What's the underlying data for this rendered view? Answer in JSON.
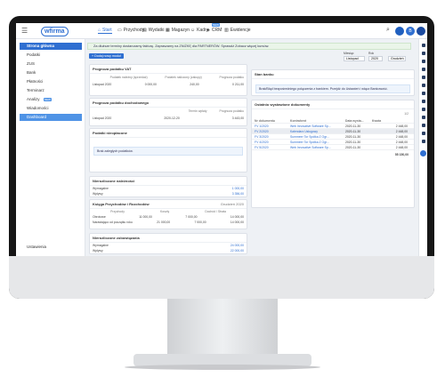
{
  "app": {
    "logo": "wfirma",
    "nav_tabs": [
      {
        "label": "Start",
        "icon": "home-icon"
      },
      {
        "label": "Przychody",
        "icon": "cart-icon"
      },
      {
        "label": "Wydatki",
        "icon": "receipt-icon"
      },
      {
        "label": "Magazyn",
        "icon": "box-icon"
      },
      {
        "label": "Kadry",
        "icon": "people-icon"
      },
      {
        "label": "CRM",
        "icon": "crm-icon",
        "badge": "NEW"
      },
      {
        "label": "Ewidencje",
        "icon": "book-icon"
      }
    ],
    "user_initial": "B"
  },
  "sidebar": {
    "header": "Strona główna",
    "items": [
      {
        "label": "Podatki",
        "icon": "percent-icon"
      },
      {
        "label": "ZUS",
        "icon": "zus-icon"
      },
      {
        "label": "Bank",
        "icon": "bank-icon"
      },
      {
        "label": "Płatności",
        "icon": "wallet-icon"
      },
      {
        "label": "Terminarz",
        "icon": "calendar-icon"
      },
      {
        "label": "Analizy",
        "icon": "chart-icon",
        "badge": "NEW"
      },
      {
        "label": "Wiadomości",
        "icon": "mail-icon"
      },
      {
        "label": "Dashboard",
        "icon": "dashboard-icon"
      }
    ],
    "footer": "Ustawienia"
  },
  "main": {
    "alert": "Za dłuższe terminy dostarczamy fakturę. Zapraszamy na ZNIŻKĘ dla PARTNERÓW. Sprawdź Zobacz więcej kursów.",
    "add_button": "+ Dodaj nowy moduł",
    "year_filter": {
      "label": "Rok",
      "value": "2020"
    },
    "month_filter": {
      "label": "Miesiąc",
      "value": "Listopad"
    },
    "month_select": "Grudzień",
    "cards": {
      "income_forecast": {
        "title": "Prognoza podatku VAT",
        "cols": [
          "Podatek należny (sprzedaż)",
          "Podatek naliczony (zakupy)",
          "Prognoza podatku"
        ],
        "row": {
          "period": "Listopad 2020",
          "a": "0 000,00",
          "b": "240,00",
          "c": "0 211,00"
        }
      },
      "income_tax": {
        "title": "Prognoza podatku dochodowego",
        "cols": [
          "Termin wpłaty",
          "Prognoza podatku"
        ],
        "row": {
          "period": "Listopad 2020",
          "due": "2020-12-20",
          "amount": "3 443,00"
        }
      },
      "unpaid": {
        "title": "Podatki nieopłacone",
        "info": "Brak zaległych podatków."
      },
      "receivables": {
        "title": "Nierozliczone należności",
        "rows": [
          {
            "label": "Wymagalne",
            "value": "1 000,00"
          },
          {
            "label": "Wpływy",
            "value": "3 356,00"
          }
        ]
      },
      "cashbook": {
        "title": "Księga Przychodów i Rozchodów",
        "filter": "Grudzień 2020",
        "cols": [
          "Przychody",
          "Koszty",
          "Dochód / Strata"
        ],
        "rows": [
          {
            "label": "Obrotowe",
            "a": "11 000,00",
            "b": "7 000,00",
            "c": "14 000,00"
          },
          {
            "label": "Narastająco od początku roku",
            "a": "21 000,00",
            "b": "7 000,00",
            "c": "14 000,00"
          }
        ]
      },
      "liabilities": {
        "title": "Nierozliczone zobowiązania",
        "rows": [
          {
            "label": "Wymagalne",
            "value": "24 000,00"
          },
          {
            "label": "Wpływy",
            "value": "22 000,00"
          }
        ]
      }
    },
    "right": {
      "banks": {
        "title": "Stan banku",
        "info": "Brak/Błąd bezpośredniego połączenia z bankiem. Przejdź do Ustawień i włącz Bankowość."
      },
      "docs": {
        "title": "Ostatnio wystawione dokumenty",
        "page": "1/2",
        "cols": [
          "Nr dokumentu",
          "Kontrahent",
          "Data wysta...",
          "Kwota"
        ],
        "rows": [
          {
            "no": "FV 1/2020",
            "client": "Web Innovative Software Sp...",
            "date": "2020-11-30",
            "amount": "2 448,00"
          },
          {
            "no": "FV 2/2020",
            "client": "Kalendarz Usługowy",
            "date": "2020-11-30",
            "amount": "2 448,00"
          },
          {
            "no": "FV 3/2020",
            "client": "Summeer Tor Spółka Z Ogr...",
            "date": "2020-11-30",
            "amount": "2 448,00"
          },
          {
            "no": "FV 4/2020",
            "client": "Summeer Tor Spółka Z Ogr...",
            "date": "2020-11-30",
            "amount": "2 448,00"
          },
          {
            "no": "FV 5/2020",
            "client": "Web Innovative Software Sp...",
            "date": "2020-11-30",
            "amount": "2 448,00"
          }
        ],
        "total": "55 150,00"
      }
    }
  },
  "colors": {
    "accent": "#2f6fd1",
    "sidebar_active": "#4f93e6",
    "rail": "#2a3f63"
  }
}
